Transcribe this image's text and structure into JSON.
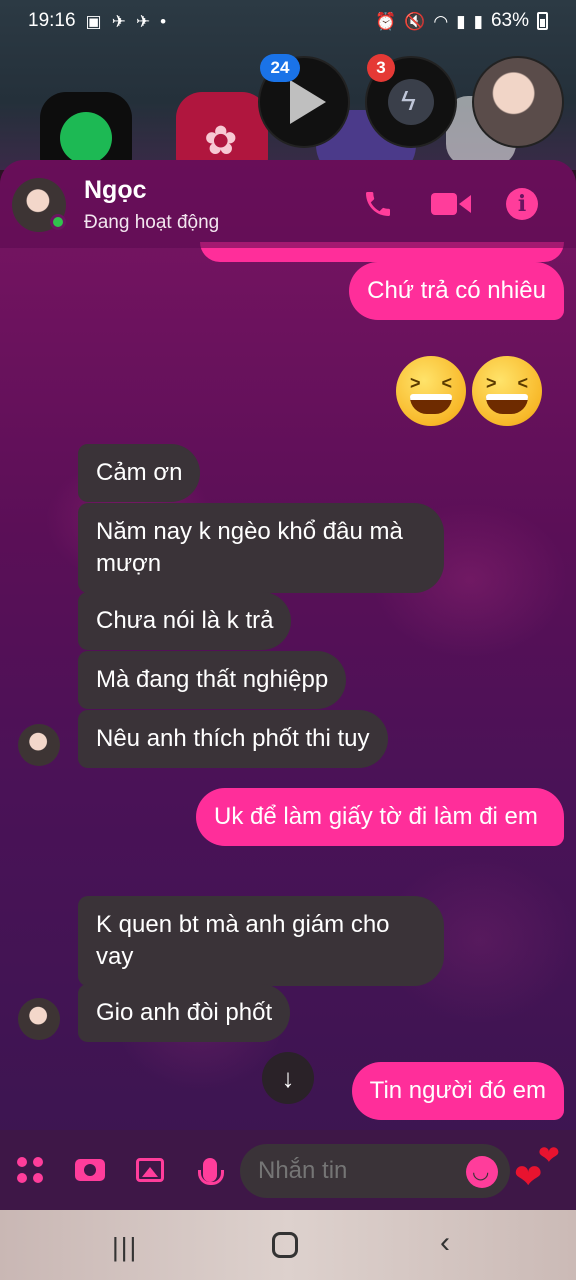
{
  "status_bar": {
    "time": "19:16",
    "battery": "63%"
  },
  "bubbles": {
    "youtube_badge": "24",
    "messenger_badge": "3"
  },
  "header": {
    "name": "Ngọc",
    "status": "Đang hoạt động"
  },
  "messages": [
    {
      "dir": "out",
      "text": "Chứ trả có nhiêu"
    },
    {
      "dir": "out",
      "text": "😆😆"
    },
    {
      "dir": "in",
      "text": "Cảm ơn"
    },
    {
      "dir": "in",
      "text": "Năm nay k ngèo khổ đâu mà mượn"
    },
    {
      "dir": "in",
      "text": "Chưa nói là k trả"
    },
    {
      "dir": "in",
      "text": "Mà đang thất nghiệpp"
    },
    {
      "dir": "in",
      "text": "Nêu anh thích phốt thi tuy"
    },
    {
      "dir": "out",
      "text": "Uk để làm giấy tờ đi làm đi em"
    },
    {
      "dir": "in",
      "text": "K quen bt mà anh giám cho vay"
    },
    {
      "dir": "in",
      "text": "Gio anh đòi phốt"
    },
    {
      "dir": "out",
      "text": "Tin người đó em"
    }
  ],
  "composer": {
    "placeholder": "Nhắn tin"
  },
  "colors": {
    "accent": "#ff2e9a",
    "incoming_bubble": "#3a3338",
    "online": "#31c24d"
  },
  "icons": {
    "header": [
      "phone-icon",
      "video-call-icon",
      "info-icon"
    ],
    "composer": [
      "apps-grid-icon",
      "camera-icon",
      "gallery-icon",
      "microphone-icon",
      "emoji-icon",
      "heart-icon"
    ]
  }
}
